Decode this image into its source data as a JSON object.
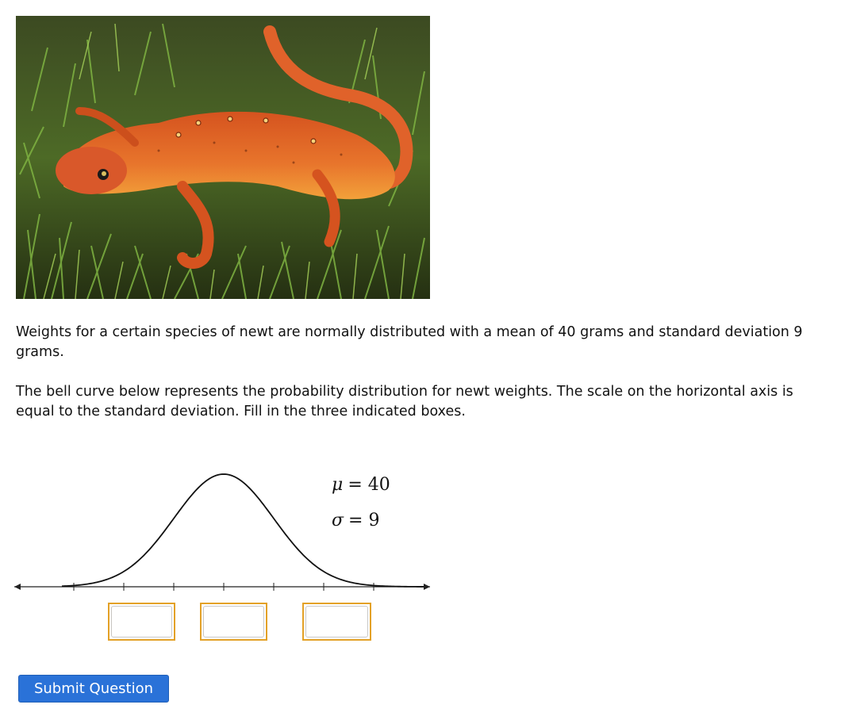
{
  "image": {
    "subject": "newt-photo"
  },
  "question": {
    "paragraph1": "Weights for a certain species of newt are normally distributed with a mean of 40 grams and standard deviation 9 grams.",
    "paragraph2": "The bell curve below represents the probability distribution for newt weights. The scale on the horizontal axis is equal to the standard deviation. Fill in the three indicated boxes."
  },
  "graph": {
    "mu_symbol": "μ",
    "mu_value": "= 40",
    "sigma_symbol": "σ",
    "sigma_value": "= 9",
    "tick_count": 7
  },
  "inputs": [
    {
      "value": "",
      "placeholder": ""
    },
    {
      "value": "",
      "placeholder": ""
    },
    {
      "value": "",
      "placeholder": ""
    }
  ],
  "submit": {
    "label": "Submit Question",
    "color": "#2a72d8"
  }
}
